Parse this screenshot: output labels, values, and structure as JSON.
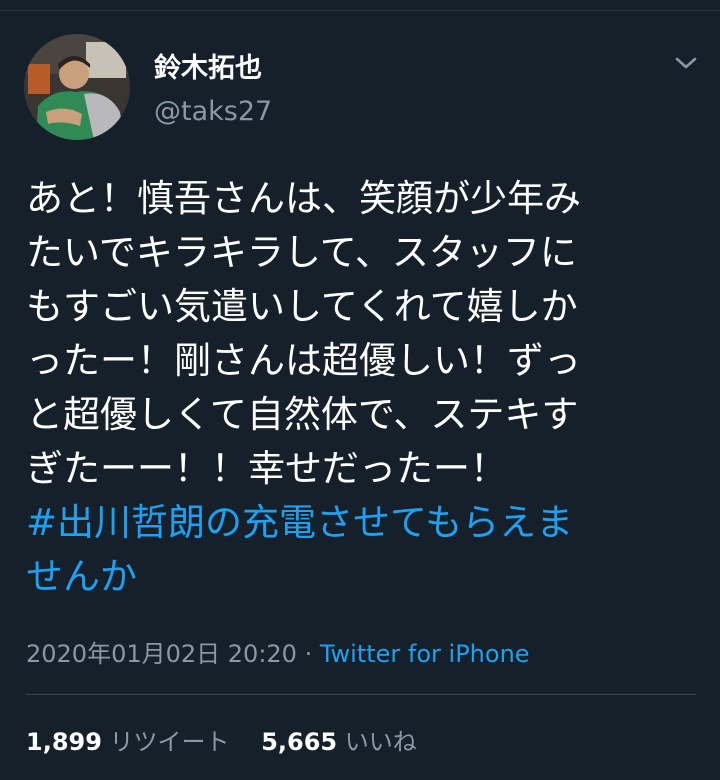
{
  "user": {
    "display_name": "鈴木拓也",
    "handle": "@taks27",
    "avatar_icon": "avatar-photo",
    "menu_icon": "chevron-down-icon"
  },
  "tweet": {
    "lines": [
      "あと！慎吾さんは、笑顔が少年み",
      "たいでキラキラして、スタッフに",
      "もすごい気遣いしてくれて嬉しか",
      "ったー！剛さんは超優しい！ずっ",
      "と超優しくて自然体で、ステキす",
      "ぎたーー！！幸せだったー！"
    ],
    "hashtag_lines": [
      "#出川哲朗の充電させてもらえま",
      "せんか"
    ]
  },
  "meta": {
    "timestamp": "2020年01月02日 20:20",
    "separator": " · ",
    "source": "Twitter for iPhone"
  },
  "stats": {
    "retweets_count": "1,899",
    "retweets_label": "リツイート",
    "likes_count": "5,665",
    "likes_label": "いいね"
  },
  "colors": {
    "background": "#15202b",
    "text": "#ffffff",
    "secondary": "#8899a6",
    "link": "#1da1f2",
    "divider": "#38444d"
  }
}
